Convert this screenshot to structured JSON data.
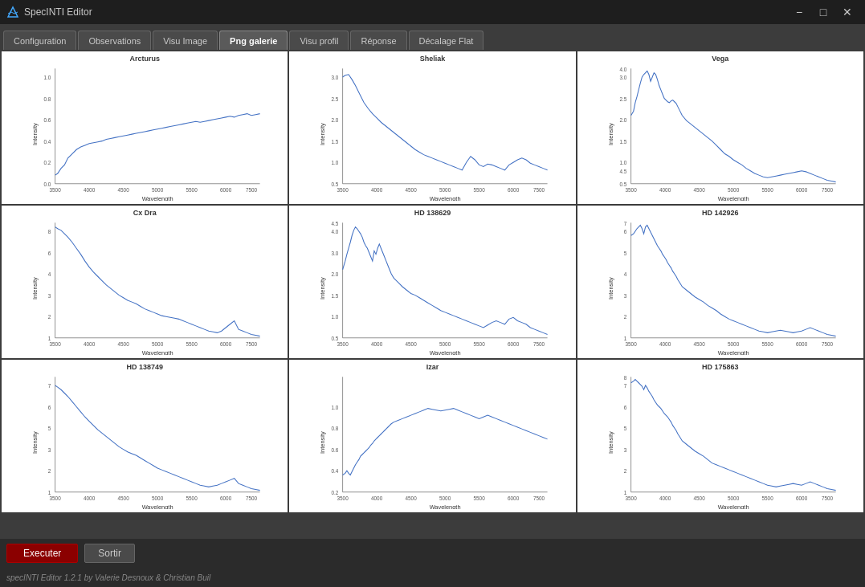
{
  "window": {
    "title": "SpecINTI Editor",
    "icon": "spectrum-icon"
  },
  "tabs": [
    {
      "id": "configuration",
      "label": "Configuration",
      "active": false
    },
    {
      "id": "observations",
      "label": "Observations",
      "active": false
    },
    {
      "id": "visu-image",
      "label": "Visu Image",
      "active": false
    },
    {
      "id": "png-galerie",
      "label": "Png galerie",
      "active": true
    },
    {
      "id": "visu-profil",
      "label": "Visu profil",
      "active": false
    },
    {
      "id": "reponse",
      "label": "Réponse",
      "active": false
    },
    {
      "id": "decalage-flat",
      "label": "Décalage Flat",
      "active": false
    }
  ],
  "charts": [
    {
      "id": "arcturus",
      "title": "Arcturus"
    },
    {
      "id": "sheliak",
      "title": "Sheliak"
    },
    {
      "id": "vega",
      "title": "Vega"
    },
    {
      "id": "cx-dra",
      "title": "Cx Dra"
    },
    {
      "id": "hd138629",
      "title": "HD 138629"
    },
    {
      "id": "hd142926",
      "title": "HD 142926"
    },
    {
      "id": "hd138749",
      "title": "HD 138749"
    },
    {
      "id": "izar",
      "title": "Izar"
    },
    {
      "id": "hd175863",
      "title": "HD 175863"
    }
  ],
  "buttons": {
    "executer": "Executer",
    "sortir": "Sortir"
  },
  "footer": {
    "text": "specINTI Editor 1.2.1 by Valerie Desnoux & Christian Buil"
  },
  "titlebar": {
    "minimize": "−",
    "maximize": "□",
    "close": "✕"
  }
}
